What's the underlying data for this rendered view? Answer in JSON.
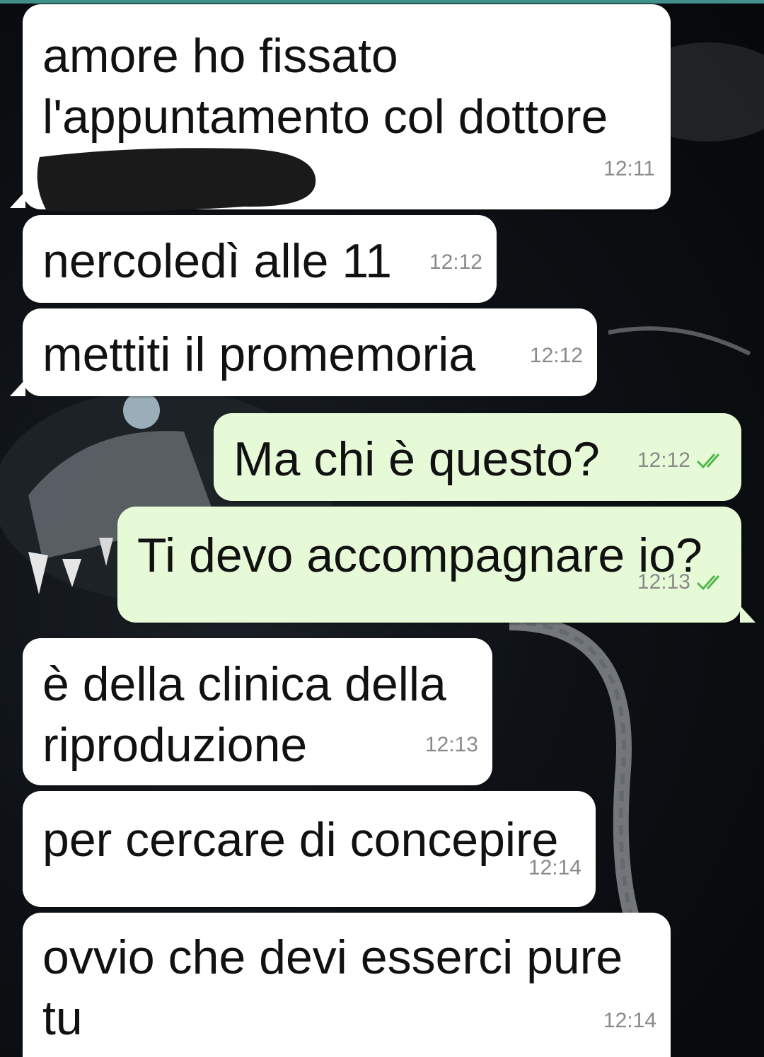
{
  "colors": {
    "incoming_bubble": "#ffffff",
    "outgoing_bubble": "#e7fad8",
    "timestamp": "#8a8a8a",
    "read_ticks": "#4fb74a",
    "wallpaper": "#0d1115"
  },
  "messages": [
    {
      "direction": "incoming",
      "lines": [
        "amore ho fissato",
        "l'appuntamento col dottore"
      ],
      "time": "12:11",
      "redacted_line": true
    },
    {
      "direction": "incoming",
      "lines": [
        "nercoledì alle 11"
      ],
      "time": "12:12"
    },
    {
      "direction": "incoming",
      "lines": [
        "mettiti il promemoria"
      ],
      "time": "12:12"
    },
    {
      "direction": "outgoing",
      "lines": [
        "Ma chi è questo?"
      ],
      "time": "12:12",
      "status": "read",
      "status_icon": "double-check-icon"
    },
    {
      "direction": "outgoing",
      "lines": [
        "Ti devo accompagnare io?"
      ],
      "time": "12:13",
      "status": "read",
      "status_icon": "double-check-icon"
    },
    {
      "direction": "incoming",
      "lines": [
        "è della clinica della",
        "riproduzione"
      ],
      "time": "12:13"
    },
    {
      "direction": "incoming",
      "lines": [
        "per cercare di concepire"
      ],
      "time": "12:14"
    },
    {
      "direction": "incoming",
      "lines": [
        "ovvio che devi esserci pure",
        "tu"
      ],
      "time": "12:14"
    }
  ]
}
